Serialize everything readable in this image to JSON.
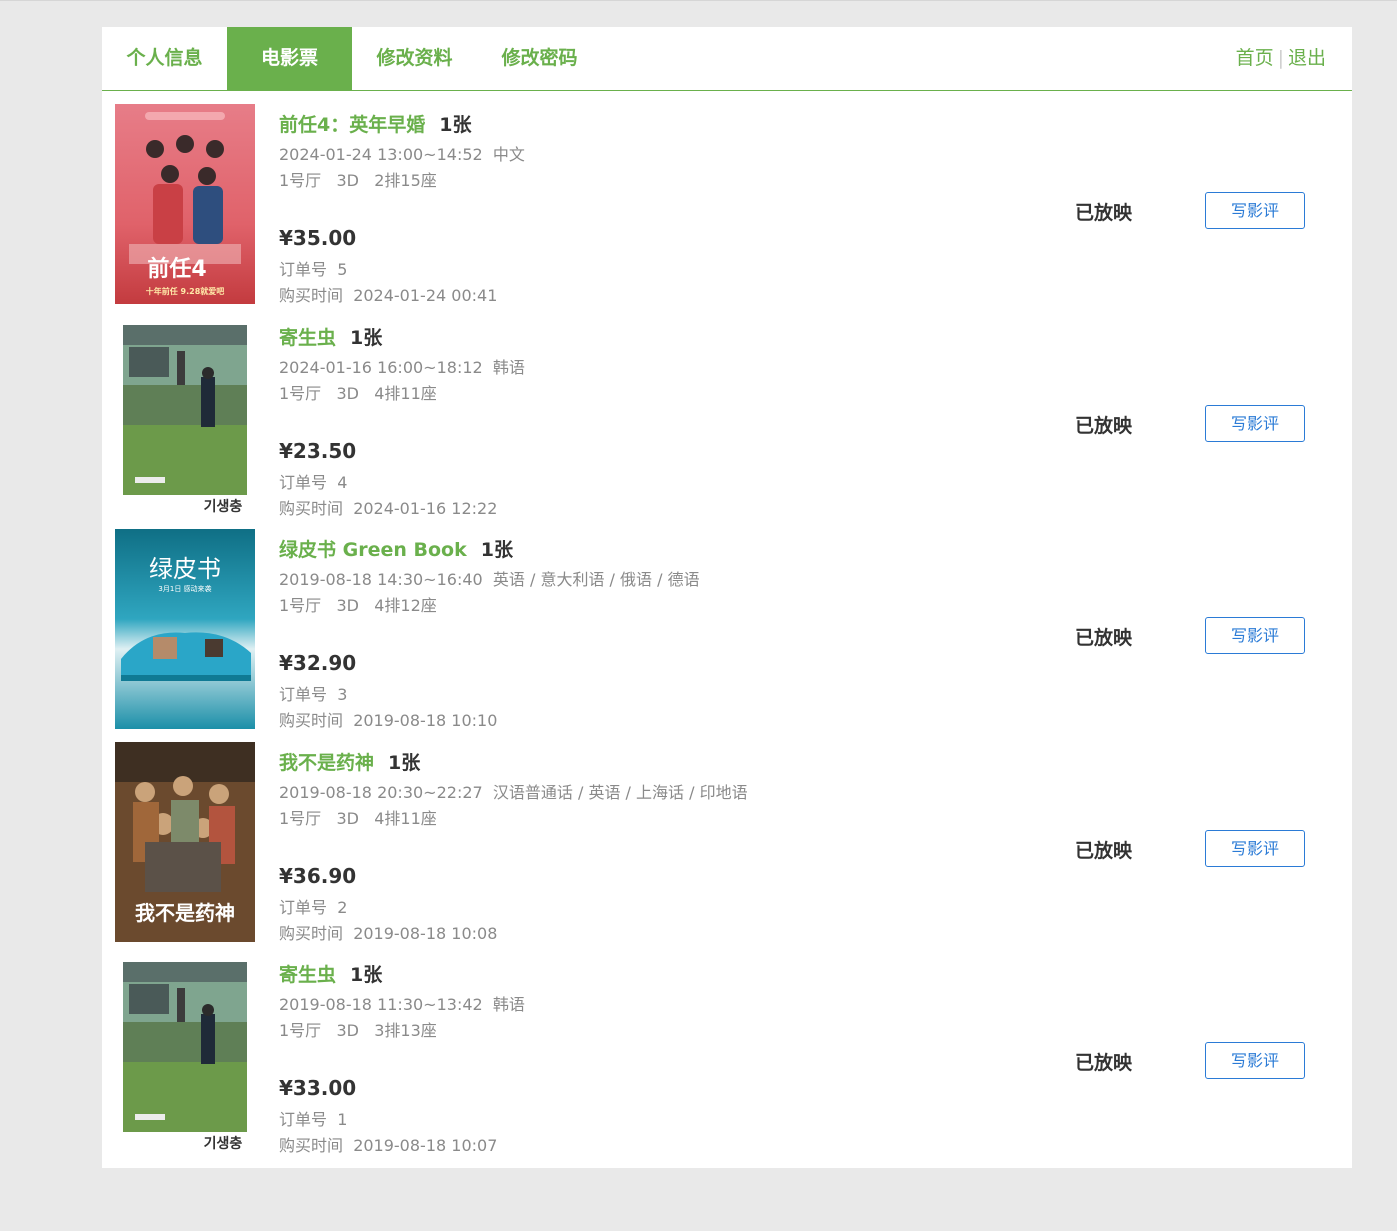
{
  "nav": {
    "tabs": [
      {
        "label": "个人信息"
      },
      {
        "label": "电影票"
      },
      {
        "label": "修改资料"
      },
      {
        "label": "修改密码"
      }
    ],
    "home_link": "首页",
    "separator": "|",
    "logout_link": "退出"
  },
  "labels": {
    "order_no": "订单号",
    "purchase_time": "购买时间",
    "currency": "¥"
  },
  "orders": [
    {
      "title": "前任4：英年早婚",
      "tickets": "1张",
      "time": "2024-01-24 13:00~14:52",
      "language": "中文",
      "hall": "1号厅",
      "format": "3D",
      "seat": "2排15座",
      "price": "35.00",
      "order_no": "5",
      "purchase_time": "2024-01-24 00:41",
      "status": "已放映",
      "review_label": "写影评",
      "poster": {
        "name": "poster-qianren4",
        "main_text": "前任4",
        "tagline": "十年前任 9.28就爱吧"
      }
    },
    {
      "title": "寄生虫",
      "tickets": "1张",
      "time": "2024-01-16 16:00~18:12",
      "language": "韩语",
      "hall": "1号厅",
      "format": "3D",
      "seat": "4排11座",
      "price": "23.50",
      "order_no": "4",
      "purchase_time": "2024-01-16 12:22",
      "status": "已放映",
      "review_label": "写影评",
      "poster": {
        "name": "poster-parasite",
        "main_text": "기생충"
      }
    },
    {
      "title": "绿皮书 Green Book",
      "tickets": "1张",
      "time": "2019-08-18 14:30~16:40",
      "language": "英语 / 意大利语 / 俄语 / 德语",
      "hall": "1号厅",
      "format": "3D",
      "seat": "4排12座",
      "price": "32.90",
      "order_no": "3",
      "purchase_time": "2019-08-18 10:10",
      "status": "已放映",
      "review_label": "写影评",
      "poster": {
        "name": "poster-green-book",
        "main_text": "绿皮书",
        "tagline": "3月1日 感动来袭"
      }
    },
    {
      "title": "我不是药神",
      "tickets": "1张",
      "time": "2019-08-18 20:30~22:27",
      "language": "汉语普通话 / 英语 / 上海话 / 印地语",
      "hall": "1号厅",
      "format": "3D",
      "seat": "4排11座",
      "price": "36.90",
      "order_no": "2",
      "purchase_time": "2019-08-18 10:08",
      "status": "已放映",
      "review_label": "写影评",
      "poster": {
        "name": "poster-dying-to-survive",
        "main_text": "我不是药神"
      }
    },
    {
      "title": "寄生虫",
      "tickets": "1张",
      "time": "2019-08-18 11:30~13:42",
      "language": "韩语",
      "hall": "1号厅",
      "format": "3D",
      "seat": "3排13座",
      "price": "33.00",
      "order_no": "1",
      "purchase_time": "2019-08-18 10:07",
      "status": "已放映",
      "review_label": "写影评",
      "poster": {
        "name": "poster-parasite",
        "main_text": "기생충"
      }
    }
  ],
  "colors": {
    "accent": "#6ab04c",
    "button_blue": "#2b7bd6",
    "muted_text": "#8a8a8a",
    "dark_text": "#333333",
    "page_bg": "#e9e9e9"
  }
}
